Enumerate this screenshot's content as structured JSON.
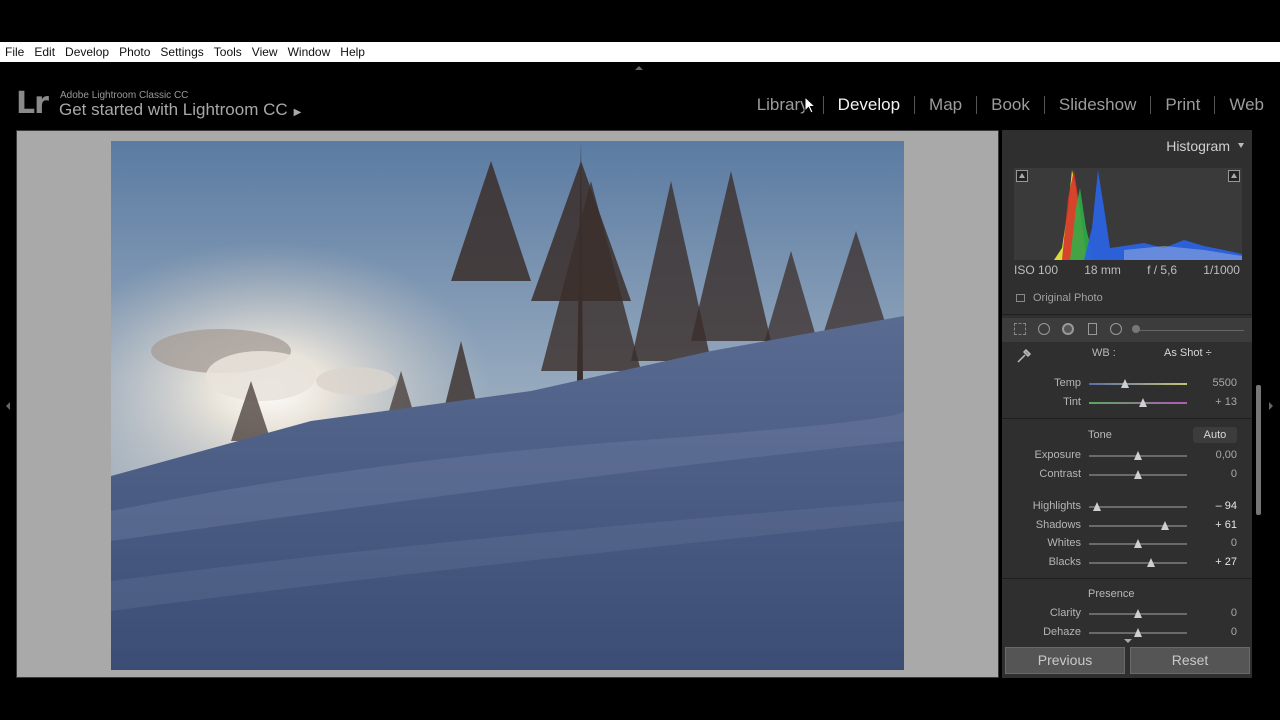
{
  "menu": [
    "File",
    "Edit",
    "Develop",
    "Photo",
    "Settings",
    "Tools",
    "View",
    "Window",
    "Help"
  ],
  "identity": {
    "logo": "Lr",
    "product": "Adobe Lightroom Classic CC",
    "promo": "Get started with Lightroom CC",
    "promo_arrow": "▶"
  },
  "modules": [
    {
      "label": "Library",
      "active": false
    },
    {
      "label": "Develop",
      "active": true
    },
    {
      "label": "Map",
      "active": false
    },
    {
      "label": "Book",
      "active": false
    },
    {
      "label": "Slideshow",
      "active": false
    },
    {
      "label": "Print",
      "active": false
    },
    {
      "label": "Web",
      "active": false
    }
  ],
  "histogram": {
    "title": "Histogram",
    "iso": "ISO 100",
    "focal": "18 mm",
    "aperture": "f / 5,6",
    "shutter": "1/1000",
    "original_photo": "Original Photo"
  },
  "basic": {
    "wb_label": "WB :",
    "wb_value": "As Shot ÷",
    "temp": {
      "label": "Temp",
      "value": "5500",
      "pos": 0.37
    },
    "tint": {
      "label": "Tint",
      "value": "+ 13",
      "pos": 0.55
    },
    "tone_label": "Tone",
    "auto_label": "Auto",
    "exposure": {
      "label": "Exposure",
      "value": "0,00",
      "pos": 0.5
    },
    "contrast": {
      "label": "Contrast",
      "value": "0",
      "pos": 0.5
    },
    "highlights": {
      "label": "Highlights",
      "value": "– 94",
      "pos": 0.08
    },
    "shadows": {
      "label": "Shadows",
      "value": "+ 61",
      "pos": 0.78
    },
    "whites": {
      "label": "Whites",
      "value": "0",
      "pos": 0.5
    },
    "blacks": {
      "label": "Blacks",
      "value": "+ 27",
      "pos": 0.63
    },
    "presence_label": "Presence",
    "clarity": {
      "label": "Clarity",
      "value": "0",
      "pos": 0.5
    },
    "dehaze": {
      "label": "Dehaze",
      "value": "0",
      "pos": 0.5
    }
  },
  "buttons": {
    "previous": "Previous",
    "reset": "Reset"
  }
}
